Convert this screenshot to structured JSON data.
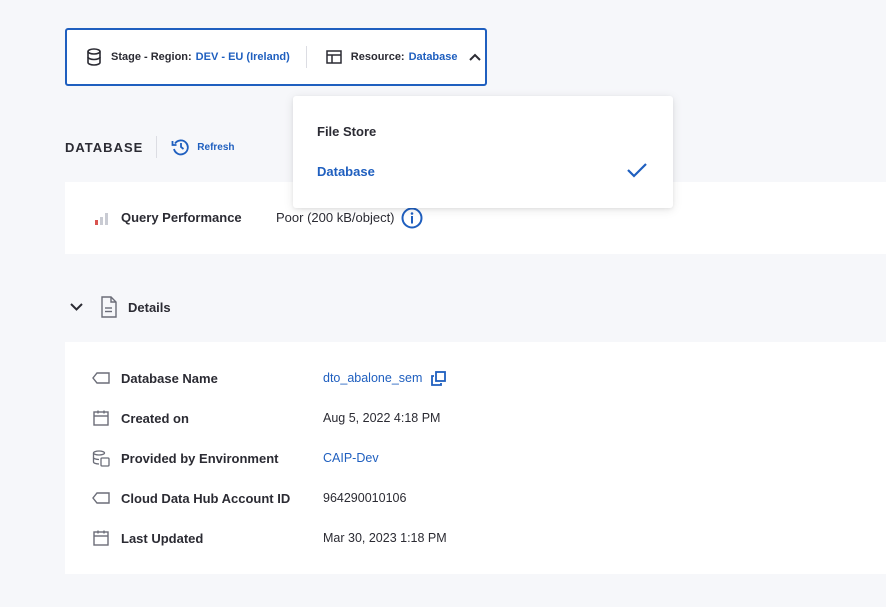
{
  "selector": {
    "stage_label": "Stage - Region:",
    "stage_value": "DEV - EU (Ireland)",
    "resource_label": "Resource:",
    "resource_value": "Database"
  },
  "dropdown": {
    "options": [
      {
        "label": "File Store",
        "selected": false
      },
      {
        "label": "Database",
        "selected": true
      }
    ]
  },
  "section": {
    "title": "DATABASE",
    "refresh_label": "Refresh"
  },
  "performance": {
    "label": "Query Performance",
    "value": "Poor (200 kB/object)"
  },
  "details": {
    "title": "Details",
    "rows": [
      {
        "label": "Database Name",
        "value": "dto_abalone_sem",
        "icon": "tag-icon",
        "is_link": true
      },
      {
        "label": "Created on",
        "value": "Aug 5, 2022 4:18 PM",
        "icon": "calendar-icon",
        "is_link": false
      },
      {
        "label": "Provided by Environment",
        "value": "CAIP-Dev",
        "icon": "environment-icon",
        "is_link": true
      },
      {
        "label": "Cloud Data Hub Account ID",
        "value": "964290010106",
        "icon": "tag-icon",
        "is_link": false
      },
      {
        "label": "Last Updated",
        "value": "Mar 30, 2023 1:18 PM",
        "icon": "calendar-icon",
        "is_link": false
      }
    ]
  },
  "colors": {
    "accent": "#1f5fbf",
    "background": "#f6f7fa",
    "card": "#ffffff",
    "text": "#2b2b33",
    "perf_bar_active": "#d9534f",
    "perf_bar_inactive": "#c9cbd3"
  }
}
